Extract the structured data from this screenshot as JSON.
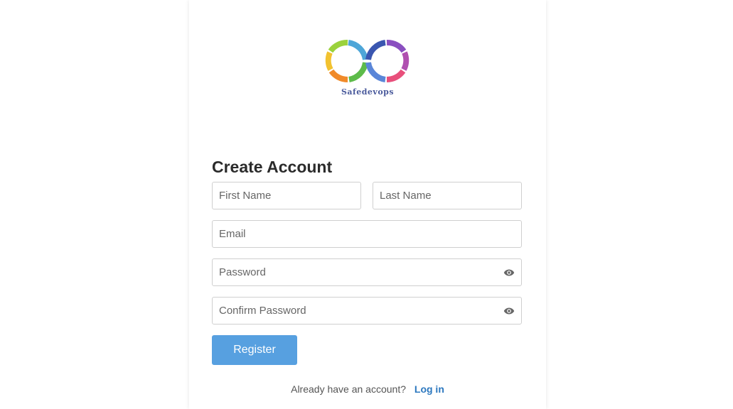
{
  "brand": {
    "name": "Safedevops",
    "colors": [
      "#9bd23c",
      "#f2c230",
      "#f08a2a",
      "#e84f7b",
      "#4ea6d8",
      "#3a56b0",
      "#8a4fc0"
    ]
  },
  "form": {
    "title": "Create Account",
    "first_name": {
      "placeholder": "First Name",
      "value": ""
    },
    "last_name": {
      "placeholder": "Last Name",
      "value": ""
    },
    "email": {
      "placeholder": "Email",
      "value": ""
    },
    "password": {
      "placeholder": "Password",
      "value": "",
      "toggle_icon": "eye-icon"
    },
    "confirm_password": {
      "placeholder": "Confirm Password",
      "value": "",
      "toggle_icon": "eye-icon"
    },
    "register_label": "Register"
  },
  "footer": {
    "question": "Already have an account?",
    "login_label": "Log in"
  },
  "theme": {
    "accent": "#57a0e0",
    "link": "#2c78bf"
  }
}
